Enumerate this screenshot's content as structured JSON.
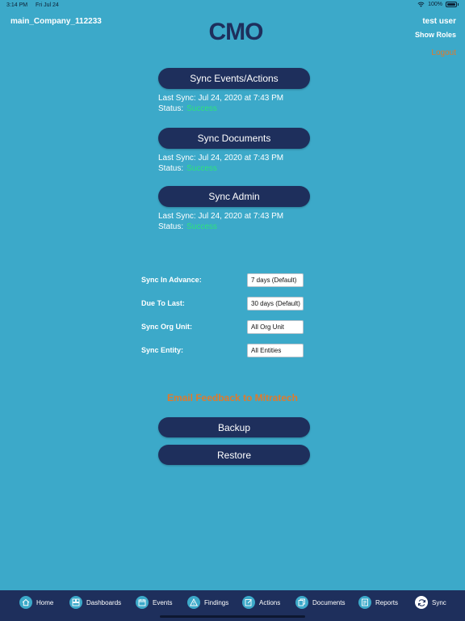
{
  "status_bar": {
    "time": "3:14 PM",
    "date": "Fri Jul 24",
    "battery": "100%"
  },
  "header": {
    "company": "main_Company_112233",
    "logo_text": "CMO",
    "user": "test user",
    "show_roles": "Show Roles",
    "logout": "Logout"
  },
  "sync_sections": [
    {
      "button": "Sync Events/Actions",
      "last_sync": "Last Sync: Jul 24, 2020 at 7:43 PM",
      "status_label": "Status:",
      "status_value": "Success"
    },
    {
      "button": "Sync Documents",
      "last_sync": "Last Sync: Jul 24, 2020 at 7:43 PM",
      "status_label": "Status:",
      "status_value": "Success"
    },
    {
      "button": "Sync Admin",
      "last_sync": "Last Sync: Jul 24, 2020 at 7:43 PM",
      "status_label": "Status:",
      "status_value": "Success"
    }
  ],
  "settings": [
    {
      "label": "Sync In Advance:",
      "value": "7 days (Default)"
    },
    {
      "label": "Due To Last:",
      "value": "30 days (Default)"
    },
    {
      "label": "Sync Org Unit:",
      "value": "All Org Unit"
    },
    {
      "label": "Sync Entity:",
      "value": "All Entities"
    }
  ],
  "feedback_link": "Email Feedback to Mitratech",
  "backup_button": "Backup",
  "restore_button": "Restore",
  "tabs": [
    {
      "label": "Home",
      "icon": "home-icon"
    },
    {
      "label": "Dashboards",
      "icon": "dashboards-icon"
    },
    {
      "label": "Events",
      "icon": "calendar-icon"
    },
    {
      "label": "Findings",
      "icon": "warning-icon"
    },
    {
      "label": "Actions",
      "icon": "edit-icon"
    },
    {
      "label": "Documents",
      "icon": "documents-icon"
    },
    {
      "label": "Reports",
      "icon": "reports-icon"
    },
    {
      "label": "Sync",
      "icon": "sync-icon"
    }
  ],
  "colors": {
    "background": "#3ca9c9",
    "button": "#1e2f5c",
    "success": "#2ee37a",
    "accent": "#e07a2c",
    "tab_bar": "#1e2f5c"
  }
}
